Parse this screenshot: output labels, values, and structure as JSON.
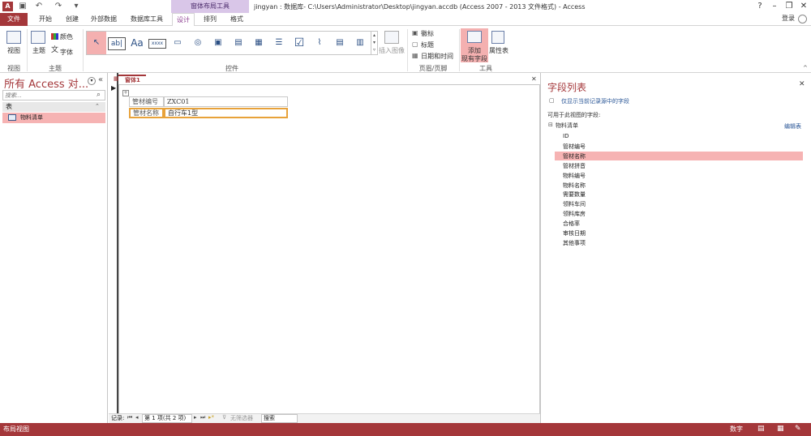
{
  "window": {
    "title": "jingyan : 数据库- C:\\Users\\Administrator\\Desktop\\jingyan.accdb (Access 2007 - 2013 文件格式) - Access",
    "app_icon": "A",
    "context_tool": "窗体布局工具",
    "help": "?",
    "login": "登录"
  },
  "tabs": [
    {
      "label": "文件"
    },
    {
      "label": "开始"
    },
    {
      "label": "创建"
    },
    {
      "label": "外部数据"
    },
    {
      "label": "数据库工具"
    },
    {
      "label": "设计"
    },
    {
      "label": "排列"
    },
    {
      "label": "格式"
    }
  ],
  "ribbon": {
    "view_label": "视图",
    "theme_label": "主题",
    "color_label": "颜色",
    "font_label": "字体",
    "gallery_texts": [
      "ab|",
      "Aa",
      "xxxx"
    ],
    "insert_image_label": "插入图像",
    "logo_label": "徽标",
    "heading_label": "标题",
    "datetime_label": "日期和时间",
    "add_fields_label_1": "添加",
    "add_fields_label_2": "现有字段",
    "property_sheet_label": "属性表",
    "groups": {
      "view": "视图",
      "themes": "主题",
      "controls": "控件",
      "header_footer": "页眉/页脚",
      "tools": "工具"
    }
  },
  "nav_pane": {
    "title": "所有 Access 对...",
    "search_placeholder": "搜索...",
    "group": "表",
    "items": [
      {
        "label": "物料清单"
      }
    ]
  },
  "document": {
    "tab": "窗体1",
    "fields": [
      {
        "label": "管材编号",
        "value": "ZXC01"
      },
      {
        "label": "管材名称",
        "value": "自行车1型"
      }
    ],
    "record_nav": {
      "prefix": "记录:",
      "position": "第 1 项(共 2 项)",
      "filter": "无筛选器",
      "search": "搜索"
    }
  },
  "field_list": {
    "title": "字段列表",
    "show_only": "仅显示当前记录源中的字段",
    "available": "可用于此视图的字段:",
    "table": "物料清单",
    "edit_table": "编辑表",
    "fields": [
      "ID",
      "管材编号",
      "管材名称",
      "管材拼音",
      "物料编号",
      "物料名称",
      "需要数量",
      "领料车间",
      "领料库房",
      "合格率",
      "审核日期",
      "其他事项"
    ],
    "selected_index": 2
  },
  "status": {
    "left": "布局视图",
    "num": "数字"
  },
  "colors": {
    "accent": "#a4373a",
    "context": "#d9c6e8",
    "selection": "#f6b3b3"
  }
}
